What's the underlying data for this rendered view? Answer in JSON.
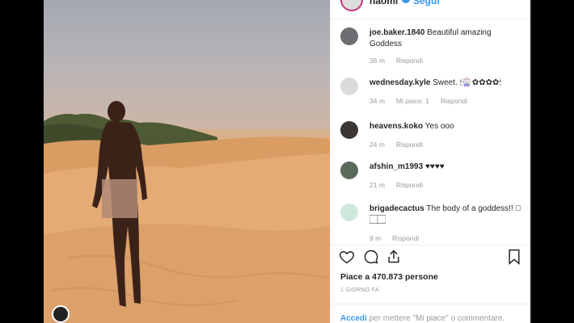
{
  "post": {
    "username": "naomi",
    "follow_label": "Seguì",
    "image_alt": "photo on sand dunes"
  },
  "comments": [
    {
      "user": "joe.baker.1840",
      "text": "Beautiful amazing Goddess",
      "age": "36 m",
      "likes": "",
      "reply": "Rispondi",
      "avatar": "person-avatar"
    },
    {
      "user": "wednesday.kyle",
      "text": "Sweet. 🕯🎡✿✿✿✿🕯",
      "age": "34 m",
      "likes": "Mi piace: 1",
      "reply": "Rispondi",
      "avatar": "blank-avatar"
    },
    {
      "user": "heavens.koko",
      "text": "Yes ooo",
      "age": "24 m",
      "likes": "",
      "reply": "Rispondi",
      "avatar": "face-avatar"
    },
    {
      "user": "afshin_m1993",
      "text": "♥♥♥♥",
      "age": "21 m",
      "likes": "",
      "reply": "Rispondi",
      "avatar": "outdoor-avatar"
    },
    {
      "user": "brigadecactus",
      "text": "The body of a goddess!! 🏻🏻🏻",
      "age": "9 m",
      "likes": "",
      "reply": "Rispondi",
      "avatar": "logo-avatar"
    }
  ],
  "likes_line": "Piace a 470.873 persone",
  "timestamp": "1 GIORNO FA",
  "footer": {
    "login_link": "Accedi",
    "text": " per mettere \"Mi piace\" o commentare."
  }
}
